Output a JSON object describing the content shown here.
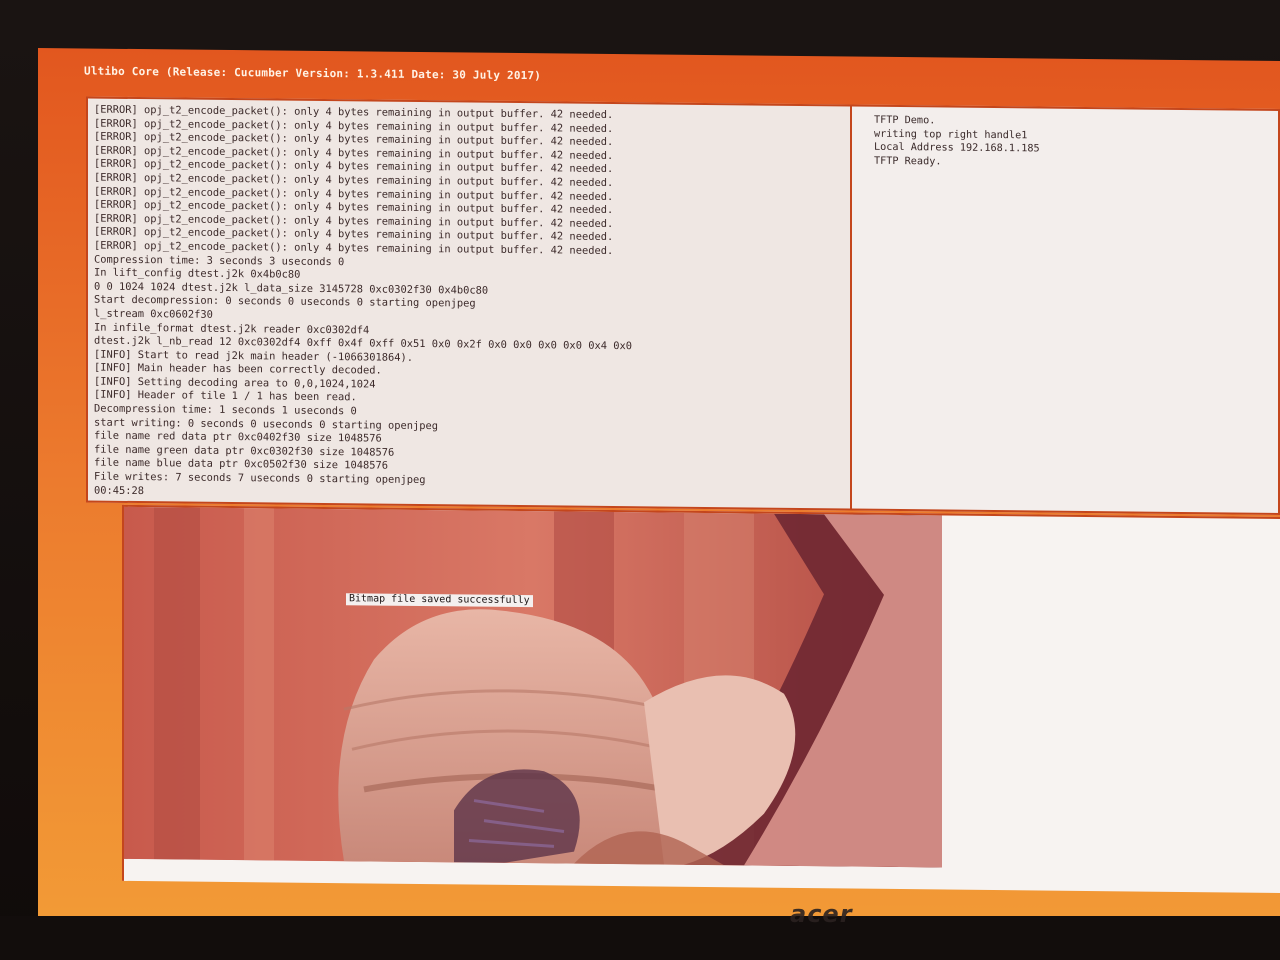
{
  "title_bar": {
    "text": "Ultibo Core (Release: Cucumber Version: 1.3.411 Date: 30 July 2017)"
  },
  "console": {
    "lines": [
      "[ERROR] opj_t2_encode_packet(): only 4 bytes remaining in output buffer. 42 needed.",
      "[ERROR] opj_t2_encode_packet(): only 4 bytes remaining in output buffer. 42 needed.",
      "[ERROR] opj_t2_encode_packet(): only 4 bytes remaining in output buffer. 42 needed.",
      "[ERROR] opj_t2_encode_packet(): only 4 bytes remaining in output buffer. 42 needed.",
      "[ERROR] opj_t2_encode_packet(): only 4 bytes remaining in output buffer. 42 needed.",
      "[ERROR] opj_t2_encode_packet(): only 4 bytes remaining in output buffer. 42 needed.",
      "[ERROR] opj_t2_encode_packet(): only 4 bytes remaining in output buffer. 42 needed.",
      "[ERROR] opj_t2_encode_packet(): only 4 bytes remaining in output buffer. 42 needed.",
      "[ERROR] opj_t2_encode_packet(): only 4 bytes remaining in output buffer. 42 needed.",
      "[ERROR] opj_t2_encode_packet(): only 4 bytes remaining in output buffer. 42 needed.",
      "[ERROR] opj_t2_encode_packet(): only 4 bytes remaining in output buffer. 42 needed.",
      "Compression time: 3 seconds 3 useconds 0",
      "In lift_config dtest.j2k 0x4b0c80",
      "0 0 1024 1024 dtest.j2k l_data_size 3145728 0xc0302f30 0x4b0c80",
      "Start decompression: 0 seconds 0 useconds 0 starting openjpeg",
      "l_stream 0xc0602f30",
      "In infile_format dtest.j2k reader 0xc0302df4",
      "dtest.j2k l_nb_read 12 0xc0302df4 0xff 0x4f 0xff 0x51 0x0 0x2f 0x0 0x0 0x0 0x0 0x4 0x0",
      "[INFO] Start to read j2k main header (-1066301864).",
      "[INFO] Main header has been correctly decoded.",
      "[INFO] Setting decoding area to 0,0,1024,1024",
      "[INFO] Header of tile 1 / 1 has been read.",
      "Decompression time: 1 seconds 1 useconds 0",
      "start writing: 0 seconds 0 useconds 0 starting openjpeg",
      "file name red data ptr 0xc0402f30 size 1048576",
      "file name green data ptr 0xc0302f30 size 1048576",
      "file name blue data ptr 0xc0502f30 size 1048576",
      "File writes: 7 seconds 7 useconds 0 starting openjpeg",
      "00:45:28"
    ]
  },
  "tftp": {
    "lines": [
      "TFTP Demo.",
      "writing top right handle1",
      "Local Address 192.168.1.185",
      "TFTP Ready."
    ]
  },
  "graphics": {
    "status_label": "Bitmap file saved successfully"
  },
  "bezel": {
    "brand": "acer"
  },
  "colors": {
    "screen_border": "#e2571f",
    "console_bg": "#efe7e3",
    "panel_border": "#c4461c",
    "text": "#3c2a2a"
  }
}
